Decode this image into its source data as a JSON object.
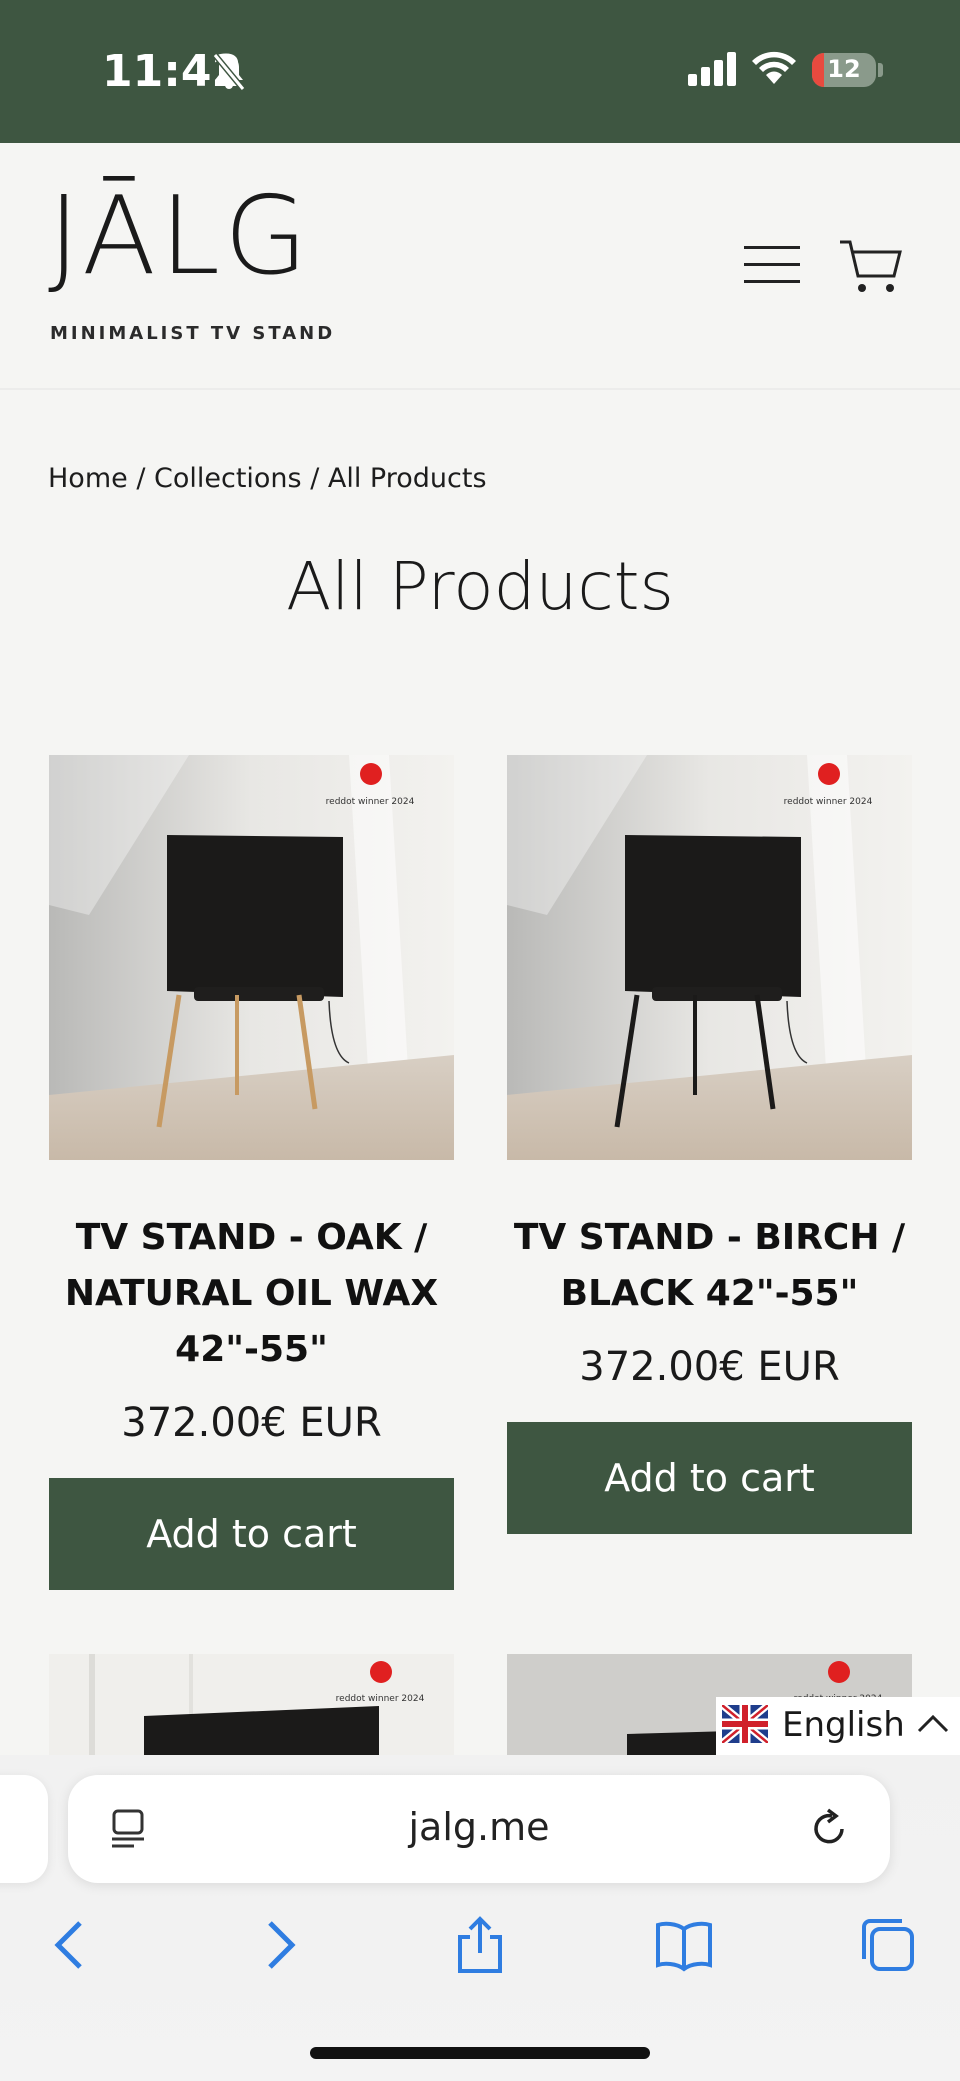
{
  "status_bar": {
    "time": "11:42",
    "battery": "12"
  },
  "brand": {
    "name": "JĀLG",
    "tagline": "MINIMALIST TV STAND"
  },
  "breadcrumb": "Home / Collections / All Products",
  "page_title": "All Products",
  "products": [
    {
      "name": "TV STAND - OAK / NATURAL OIL WAX 42\"-55\"",
      "price": "372.00€ EUR",
      "cta": "Add to cart",
      "badge": "reddot winner 2024"
    },
    {
      "name": "TV STAND - BIRCH / BLACK 42\"-55\"",
      "price": "372.00€ EUR",
      "cta": "Add to cart",
      "badge": "reddot winner 2024"
    }
  ],
  "partial_badges": [
    "reddot winner 2024",
    "reddot winner 2024"
  ],
  "language": {
    "label": "English"
  },
  "browser": {
    "url": "jalg.me"
  },
  "colors": {
    "brand_green": "#3e5641",
    "background": "#f5f5f3"
  }
}
